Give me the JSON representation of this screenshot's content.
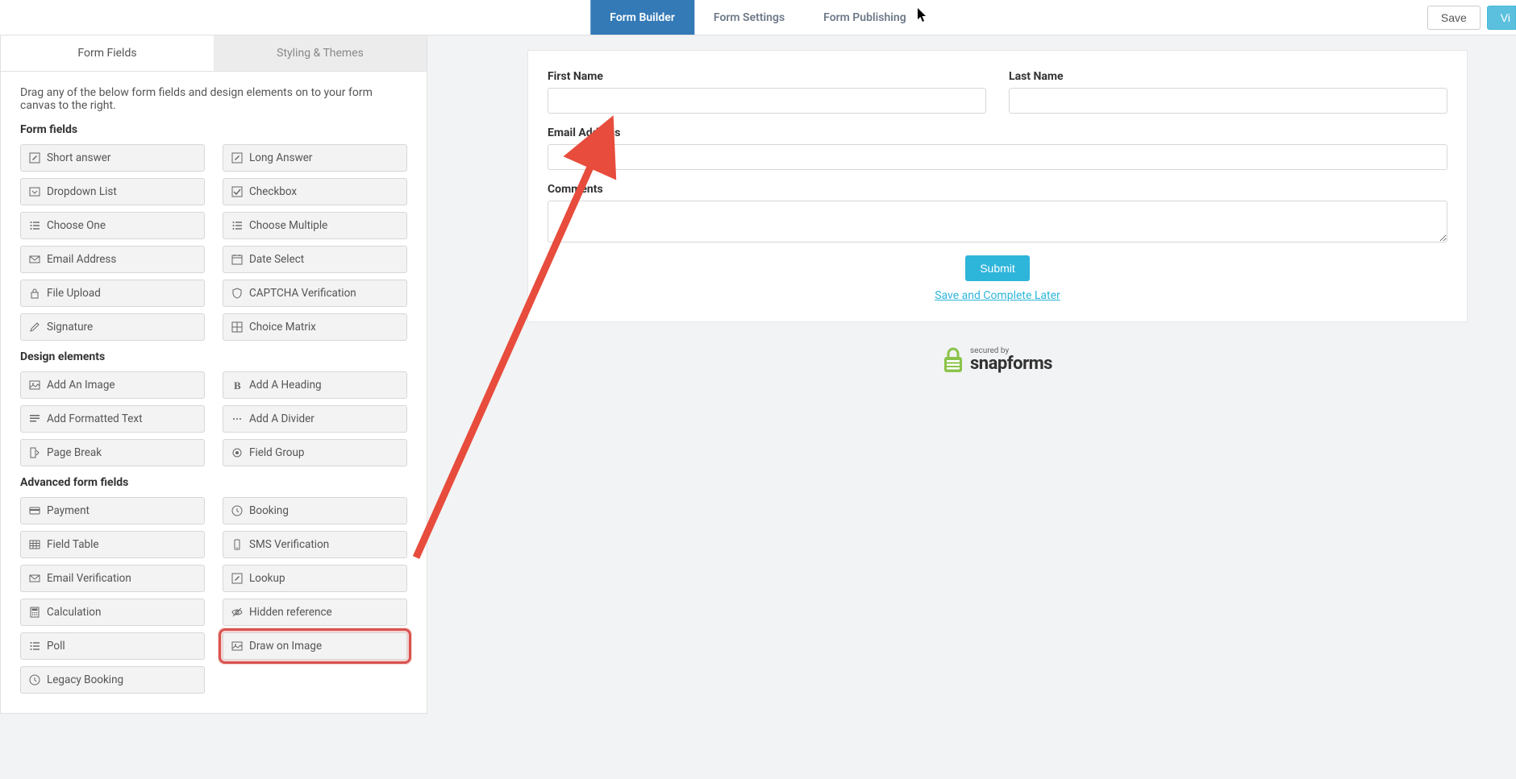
{
  "topnav": {
    "tabs": [
      {
        "label": "Form Builder"
      },
      {
        "label": "Form Settings"
      },
      {
        "label": "Form Publishing"
      }
    ],
    "save_label": "Save",
    "view_label": "Vi"
  },
  "left_panel": {
    "tabs": [
      {
        "label": "Form Fields"
      },
      {
        "label": "Styling & Themes"
      }
    ],
    "instructions": "Drag any of the below form fields and design elements on to your form canvas to the right.",
    "sections": {
      "form_fields_title": "Form fields",
      "design_elements_title": "Design elements",
      "advanced_title": "Advanced form fields"
    },
    "form_fields": [
      {
        "label": "Short answer",
        "icon": "edit-icon"
      },
      {
        "label": "Long Answer",
        "icon": "edit-icon"
      },
      {
        "label": "Dropdown List",
        "icon": "dropdown-icon"
      },
      {
        "label": "Checkbox",
        "icon": "checkbox-icon"
      },
      {
        "label": "Choose One",
        "icon": "list-icon"
      },
      {
        "label": "Choose Multiple",
        "icon": "list-icon"
      },
      {
        "label": "Email Address",
        "icon": "mail-icon"
      },
      {
        "label": "Date Select",
        "icon": "calendar-icon"
      },
      {
        "label": "File Upload",
        "icon": "lock-icon"
      },
      {
        "label": "CAPTCHA Verification",
        "icon": "shield-icon"
      },
      {
        "label": "Signature",
        "icon": "pencil-icon"
      },
      {
        "label": "Choice Matrix",
        "icon": "grid-icon"
      }
    ],
    "design_elements": [
      {
        "label": "Add An Image",
        "icon": "image-icon"
      },
      {
        "label": "Add A Heading",
        "icon": "bold-icon"
      },
      {
        "label": "Add Formatted Text",
        "icon": "text-icon"
      },
      {
        "label": "Add A Divider",
        "icon": "divider-icon"
      },
      {
        "label": "Page Break",
        "icon": "pagebreak-icon"
      },
      {
        "label": "Field Group",
        "icon": "group-icon"
      }
    ],
    "advanced_fields": [
      {
        "label": "Payment",
        "icon": "card-icon"
      },
      {
        "label": "Booking",
        "icon": "clock-icon"
      },
      {
        "label": "Field Table",
        "icon": "table-icon"
      },
      {
        "label": "SMS Verification",
        "icon": "phone-icon"
      },
      {
        "label": "Email Verification",
        "icon": "mail-icon"
      },
      {
        "label": "Lookup",
        "icon": "edit-icon"
      },
      {
        "label": "Calculation",
        "icon": "calc-icon"
      },
      {
        "label": "Hidden reference",
        "icon": "eye-off-icon"
      },
      {
        "label": "Poll",
        "icon": "list-icon"
      },
      {
        "label": "Draw on Image",
        "icon": "image-icon",
        "highlighted": true
      },
      {
        "label": "Legacy Booking",
        "icon": "clock-icon"
      }
    ]
  },
  "form_canvas": {
    "first_name_label": "First Name",
    "last_name_label": "Last Name",
    "email_label": "Email Address",
    "comments_label": "Comments",
    "submit_label": "Submit",
    "save_later_label": "Save and Complete Later"
  },
  "secured_badge": {
    "secured_by": "secured by",
    "brand": "snapforms"
  }
}
